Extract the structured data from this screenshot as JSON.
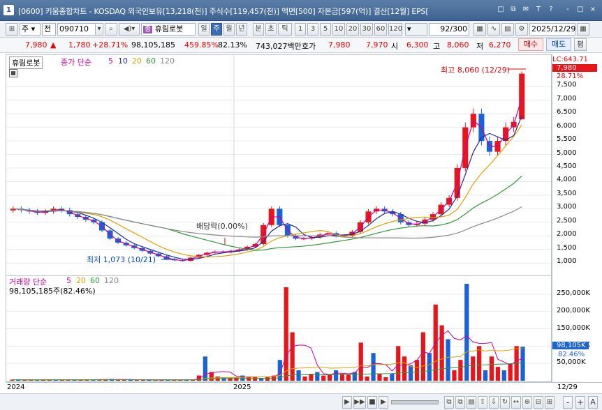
{
  "title": {
    "app_number": "1",
    "text": "[0600] 키움종합차트 - KOSDAQ 외국인보유[13,218(천)] 주식수[119,457(천)] 액면[500] 자본금[597(억)] 결산[12월] EPS["
  },
  "window_buttons": [
    "□",
    "⧉",
    "✉",
    "T",
    "?",
    "-",
    "□",
    "×"
  ],
  "toolbar": {
    "period_label": "주",
    "prev_label": "전",
    "code_value": "090710",
    "stock_name": "휴림로봇",
    "stock_badge": "종",
    "timeframes": [
      "일",
      "주",
      "월",
      "년",
      "분",
      "초",
      "틱"
    ],
    "active_timeframe": "주",
    "intervals": [
      "1",
      "3",
      "5",
      "10",
      "20",
      "30",
      "60",
      "120"
    ],
    "count_value": "92",
    "count_total": "/300",
    "date_value": "2025/12/29"
  },
  "infobar": {
    "price": "7,980",
    "up_arrow": "▲",
    "change": "1,780",
    "change_pct": "+28.71%",
    "volume": "98,105,185",
    "volume_ratio": "459.85%",
    "turnover": "82.13%",
    "trade_amount": "743,027백만",
    "quote_label": "호가",
    "ask_price": "7,980",
    "bid_price": "7,970",
    "open_label": "시",
    "open_value": "6,300",
    "high_label": "고",
    "high_value": "8,060",
    "low_label": "저",
    "low_value": "6,270",
    "buy_label": "매수",
    "sell_label": "매도",
    "eval_label": "평"
  },
  "chart_panel": {
    "stock_tag": "휴림로봇",
    "ma_legend_prefix": "종가 단순",
    "ma_periods": [
      "5",
      "10",
      "20",
      "60",
      "120"
    ],
    "ma_colors": [
      "#cc0099",
      "#1a2ca6",
      "#e0a000",
      "#2e9a3a",
      "#888888"
    ],
    "lc_label": "LC:643.71",
    "price_tag": "7,980",
    "pct_tag": "28.71%",
    "high_annotation": "최고 8,060 (12/29)",
    "low_annotation": "최저 1,073 (10/21)",
    "dividend_annotation": "배당락(0.00%)",
    "price_ticks": [
      "7,500",
      "7,000",
      "6,500",
      "6,000",
      "5,500",
      "5,000",
      "4,500",
      "4,000",
      "3,500",
      "3,000",
      "2,500",
      "2,000",
      "1,500",
      "1,000"
    ]
  },
  "volume_panel": {
    "legend_prefix": "거래량 단순",
    "ma_periods": [
      "5",
      "20",
      "60",
      "120"
    ],
    "ma_colors": [
      "#cc0099",
      "#e0a000",
      "#2e9a3a",
      "#888888"
    ],
    "current_volume": "98,105,185주(82.46%)",
    "volume_tag": "98,105K",
    "pct_tag": "82.46%",
    "volume_ticks": [
      "250,000K",
      "200,000K",
      "150,000K",
      "100,000K",
      "50,000K"
    ]
  },
  "xaxis": {
    "labels": [
      "2024",
      "2025"
    ],
    "last_date": "12/29"
  },
  "bottombar": {
    "buttons": [
      "▶",
      "▶▶",
      "■",
      "▶",
      "-",
      "+",
      "A"
    ]
  },
  "colors": {
    "up": "#e8161b",
    "down": "#1a62d8",
    "titlebar": "#4a6e9c",
    "active": "#3d6cb0"
  },
  "chart_data": [
    {
      "type": "candlestick",
      "title": "휴림로봇 주봉",
      "x": [
        "2024-01",
        "2024-02",
        "2024-03",
        "2024-04",
        "2024-05",
        "2024-06",
        "2024-07",
        "2024-08",
        "2024-09",
        "2024-10",
        "2024-11",
        "2024-12",
        "2025-01",
        "2025-02",
        "2025-03",
        "2025-04",
        "2025-05",
        "2025-06",
        "2025-07",
        "2025-08",
        "2025-09",
        "2025-10",
        "2025-11",
        "2025-12"
      ],
      "weekly_close": [
        3000,
        2950,
        2900,
        2850,
        2900,
        3000,
        2950,
        2800,
        2700,
        2600,
        2500,
        2200,
        1900,
        1750,
        1650,
        1550,
        1450,
        1350,
        1250,
        1150,
        1100,
        1080,
        1200,
        1300,
        1380,
        1420,
        1400,
        1450,
        1500,
        1600,
        1700,
        2400,
        3000,
        2400,
        2000,
        1900,
        1900,
        1950,
        2050,
        2100,
        2000,
        2000,
        2150,
        2500,
        2900,
        3000,
        2900,
        2800,
        2500,
        2400,
        2450,
        2600,
        2800,
        3150,
        3400,
        4500,
        6000,
        6500,
        5500,
        5100,
        5500,
        6000,
        6200,
        7980
      ],
      "ylim": [
        800,
        8200
      ],
      "annotations": [
        "최고 8,060 (12/29)",
        "최저 1,073 (10/21)",
        "배당락(0.00%)"
      ]
    },
    {
      "type": "bar",
      "title": "거래량",
      "ylim": [
        0,
        290000
      ],
      "values": [
        3000,
        3000,
        2500,
        2500,
        2000,
        3000,
        4000,
        2000,
        2000,
        2500,
        3000,
        3000,
        4000,
        3000,
        3000,
        4000,
        5000,
        3000,
        3000,
        2500,
        2000,
        3000,
        2000,
        1500,
        2500,
        3000,
        2500,
        3000,
        3000,
        3000,
        15000,
        70000,
        25000,
        12000,
        10000,
        8000,
        10000,
        15000,
        12000,
        10000,
        8000,
        10000,
        15000,
        60000,
        270000,
        140000,
        30000,
        12000,
        20000,
        25000,
        15000,
        18000,
        30000,
        20000,
        18000,
        25000,
        110000,
        12000,
        80000,
        20000,
        10000,
        20000,
        100000,
        70000,
        45000,
        60000,
        140000,
        80000,
        220000,
        160000,
        120000,
        30000,
        60000,
        280000,
        70000,
        100000,
        30000,
        70000,
        40000,
        30000,
        50000,
        100000,
        98105
      ]
    }
  ]
}
